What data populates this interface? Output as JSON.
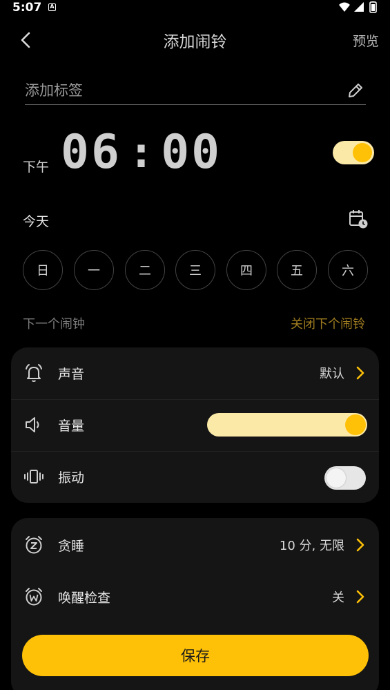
{
  "status_bar": {
    "time": "5:07",
    "notification_glyph": "A"
  },
  "header": {
    "title": "添加闹铃",
    "preview_label": "预览"
  },
  "label_field": {
    "placeholder": "添加标签",
    "value": ""
  },
  "time": {
    "ampm": "下午",
    "hour": "06",
    "separator": ":",
    "minute": "00"
  },
  "alarm_enabled": true,
  "date": {
    "label": "今天"
  },
  "weekdays": [
    "日",
    "一",
    "二",
    "三",
    "四",
    "五",
    "六"
  ],
  "next_alarm": {
    "label": "下一个闹钟",
    "action": "关闭下个闹铃"
  },
  "sound_settings": {
    "sound": {
      "label": "声音",
      "value": "默认"
    },
    "volume": {
      "label": "音量",
      "level": 1.0
    },
    "vibration": {
      "label": "振动",
      "enabled": false
    }
  },
  "more_settings": {
    "snooze": {
      "label": "贪睡",
      "value": "10 分, 无限"
    },
    "wake_check": {
      "label": "唤醒检查",
      "value": "关"
    }
  },
  "save_label": "保存",
  "colors": {
    "accent": "#ffc107",
    "accent_light": "#fbe9a8",
    "background": "#000000",
    "card": "#151515",
    "muted_action": "#a07c20"
  }
}
